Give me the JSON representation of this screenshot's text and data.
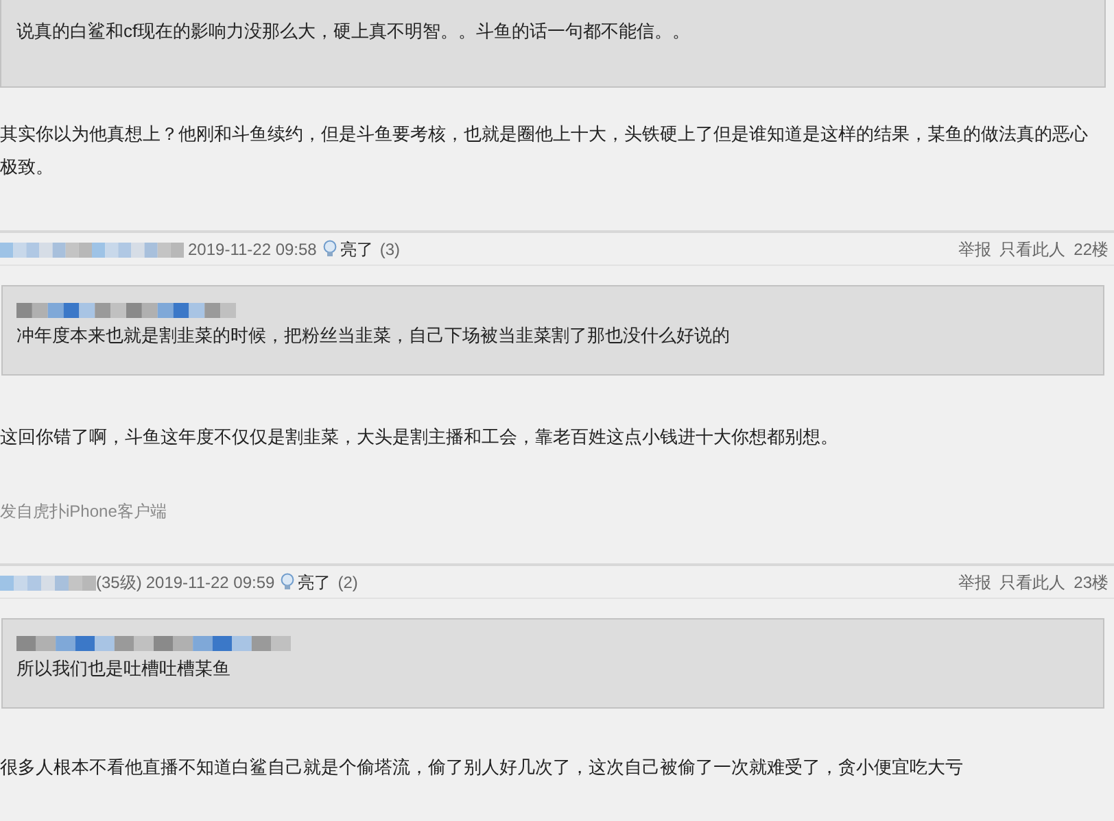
{
  "top": {
    "quote": "说真的白鲨和cf现在的影响力没那么大，硬上真不明智。。斗鱼的话一句都不能信。。",
    "body": "其实你以为他真想上？他刚和斗鱼续约，但是斗鱼要考核，也就是圈他上十大，头铁硬上了但是谁知道是这样的结果，某鱼的做法真的恶心极致。"
  },
  "posts": [
    {
      "time": "2019-11-22 09:58",
      "light": "亮了",
      "light_count": "(3)",
      "report": "举报",
      "only": "只看此人",
      "floor": "22楼",
      "quote": "冲年度本来也就是割韭菜的时候，把粉丝当韭菜，自己下场被当韭菜割了那也没什么好说的",
      "body": "这回你错了啊，斗鱼这年度不仅仅是割韭菜，大头是割主播和工会，靠老百姓这点小钱进十大你想都别想。",
      "source": "发自虎扑iPhone客户端"
    },
    {
      "level": "(35级)",
      "time": "2019-11-22 09:59",
      "light": "亮了",
      "light_count": "(2)",
      "report": "举报",
      "only": "只看此人",
      "floor": "23楼",
      "quote": "所以我们也是吐槽吐槽某鱼",
      "body": "很多人根本不看他直播不知道白鲨自己就是个偷塔流，偷了别人好几次了，这次自己被偷了一次就难受了，贪小便宜吃大亏"
    }
  ]
}
